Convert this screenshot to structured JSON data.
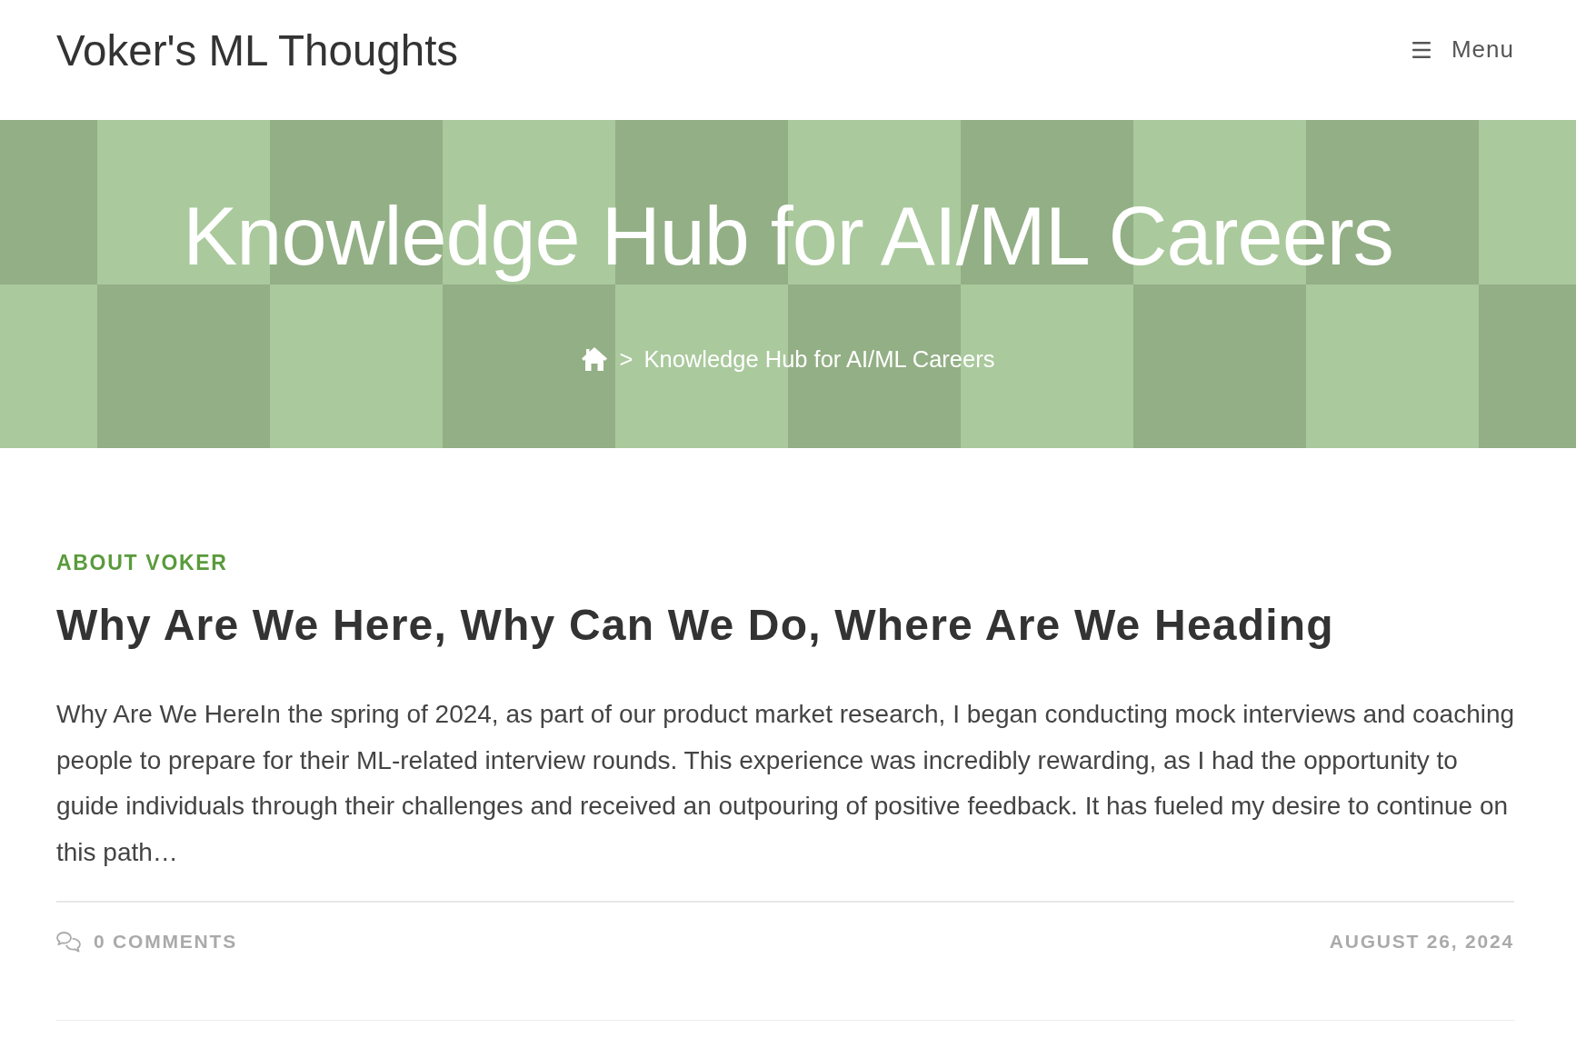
{
  "header": {
    "site_title": "Voker's ML Thoughts",
    "menu": {
      "label": "Menu"
    }
  },
  "page_header": {
    "title": "Knowledge Hub for AI/ML Careers",
    "breadcrumb": {
      "separator": ">",
      "current": "Knowledge Hub for AI/ML Careers"
    }
  },
  "posts": [
    {
      "category": "ABOUT VOKER",
      "title": "Why Are We Here, Why Can We Do, Where Are We Heading",
      "excerpt": "Why Are We HereIn the spring of 2024, as part of our product market research, I began conducting mock interviews and coaching people to prepare for their ML-related interview rounds. This experience was incredibly rewarding, as I had the opportunity to guide individuals through their challenges and received an outpouring of positive feedback. It has fueled my desire to continue on this path…",
      "comments": "0 COMMENTS",
      "date": "AUGUST 26, 2024"
    }
  ]
}
